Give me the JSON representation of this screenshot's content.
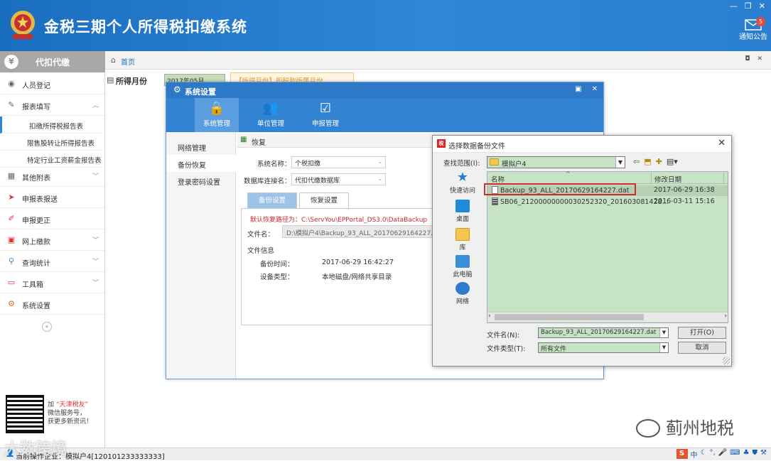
{
  "app": {
    "title": "金税三期个人所得税扣缴系统",
    "notice_label": "通知公告",
    "notice_count": "5"
  },
  "sidebar": {
    "header": "代扣代缴",
    "items": [
      {
        "label": "人员登记",
        "icon": "person-icon"
      },
      {
        "label": "报表填写",
        "icon": "edit-icon"
      },
      {
        "label": "其他附表",
        "icon": "grid-icon"
      },
      {
        "label": "申报表报送",
        "icon": "send-icon"
      },
      {
        "label": "申报更正",
        "icon": "pencil-icon"
      },
      {
        "label": "网上缴款",
        "icon": "payment-icon"
      },
      {
        "label": "查询统计",
        "icon": "search-icon"
      },
      {
        "label": "工具箱",
        "icon": "toolbox-icon"
      },
      {
        "label": "系统设置",
        "icon": "settings-icon"
      }
    ],
    "subitems": [
      "扣缴所得税报告表",
      "限售股转让所得报告表",
      "特定行业工资薪金报告表"
    ],
    "qr_text": {
      "prefix": "加",
      "brand": "“天津税友”",
      "line2": "微信服务号，",
      "line3": "获更多新资讯！"
    }
  },
  "breadcrumb": {
    "home": "首页"
  },
  "month": {
    "label": "所得月份",
    "value": "2017年05月",
    "hint": "【所得月份】即税款所属月份"
  },
  "sys_dialog": {
    "title": "系统设置",
    "toolbar": [
      "系统管理",
      "单位管理",
      "申报管理"
    ],
    "left_menu": [
      "网络管理",
      "备份恢复",
      "登录密码设置"
    ],
    "section_title": "恢复",
    "system_name_label": "系统名称：",
    "system_name_value": "个税扣缴",
    "db_label": "数据库连接名：",
    "db_value": "代扣代缴数据库",
    "tabs": [
      "备份设置",
      "恢复设置"
    ],
    "default_path": "默认恢复路径为：C:\\ServYou\\EPPortal_DS3.0\\DataBackup",
    "file_label": "文件名：",
    "file_value": "D:\\模拟户4\\Backup_93_ALL_20170629164227.dat",
    "info_label": "文件信息",
    "backup_time_label": "备份时间：",
    "backup_time_value": "2017-06-29 16:42:27",
    "device_label": "设备类型：",
    "device_value": "本地磁盘/网络共享目录"
  },
  "file_dialog": {
    "title": "选择数据备份文件",
    "lookin_label": "查找范围(I):",
    "lookin_value": "模拟户4",
    "places": [
      "快速访问",
      "桌面",
      "库",
      "此电脑",
      "网络"
    ],
    "col_name": "名称",
    "col_date": "修改日期",
    "files": [
      {
        "name": "Backup_93_ALL_20170629164227.dat",
        "date": "2017-06-29 16:38"
      },
      {
        "name": "SB06_21200000000030252320_201603081428...",
        "date": "2016-03-11 15:16"
      }
    ],
    "filename_label": "文件名(N):",
    "filename_value": "Backup_93_ALL_20170629164227.dat",
    "filetype_label": "文件类型(T):",
    "filetype_value": "所有文件",
    "open_label": "打开(O)",
    "cancel_label": "取消"
  },
  "status": {
    "text": "当前操作企业：模拟户4[120101233333333]"
  },
  "watermarks": {
    "left": "大数跨境",
    "right": "蓟州地税"
  },
  "colors": {
    "header_blue": "#2f86d6",
    "dialog_blue": "#3283d2",
    "list_green": "#c7e3c5",
    "highlight_red": "#d32c2c"
  }
}
